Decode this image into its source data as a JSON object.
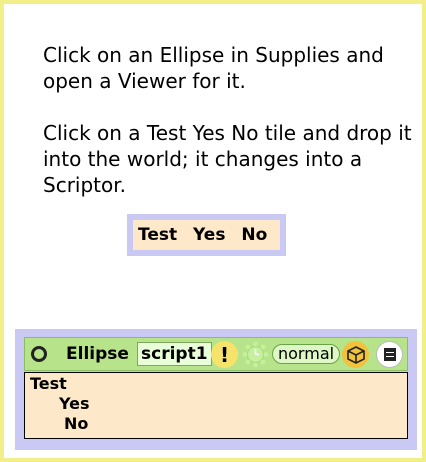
{
  "instructions": {
    "paragraph1": "Click on an Ellipse in Supplies and open a Viewer for it.",
    "paragraph2": "Click on a Test Yes No tile and drop it into the world; it changes into a Scriptor."
  },
  "test_tile": {
    "test": "Test",
    "yes": "Yes",
    "no": "No"
  },
  "scriptor": {
    "object_name": "Ellipse",
    "script_name": "script1",
    "fire_label": "!",
    "status": "normal",
    "body": {
      "test": "Test",
      "yes": "Yes",
      "no": "No"
    }
  },
  "colors": {
    "frame": "#f2ee8a",
    "tile_border": "#c9c9f3",
    "tile_fill": "#fde9c9",
    "header_green": "#b7e38a"
  },
  "icons": [
    "circle-icon",
    "exclamation-icon",
    "clock-icon",
    "paws-icon",
    "menu-icon"
  ]
}
